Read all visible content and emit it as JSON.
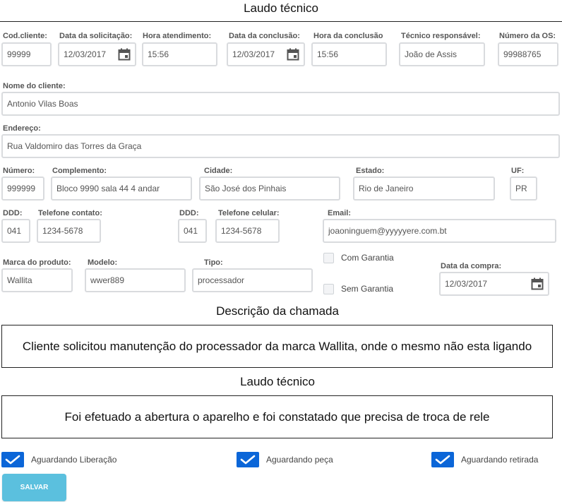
{
  "title": "Laudo técnico",
  "row1": {
    "cod_label": "Cod.cliente:",
    "cod_value": "99999",
    "data_sol_label": "Data da solicitação:",
    "data_sol_value": "12/03/2017",
    "hora_at_label": "Hora atendimento:",
    "hora_at_value": "15:56",
    "data_conc_label": "Data da conclusão:",
    "data_conc_value": "12/03/2017",
    "hora_conc_label": "Hora da conclusão",
    "hora_conc_value": "15:56",
    "tecnico_label": "Técnico responsável:",
    "tecnico_value": "João de Assis",
    "os_label": "Número da OS:",
    "os_value": "99988765"
  },
  "cliente": {
    "label": "Nome do cliente:",
    "value": "Antonio Vilas Boas"
  },
  "endereco": {
    "label": "Endereço:",
    "value": "Rua Valdomiro das Torres da Graça"
  },
  "row4": {
    "numero_label": "Número:",
    "numero_value": "999999",
    "complemento_label": "Complemento:",
    "complemento_value": "Bloco 9990 sala 44 4 andar",
    "cidade_label": "Cidade:",
    "cidade_value": "São José dos Pinhais",
    "estado_label": "Estado:",
    "estado_value": "Rio de Janeiro",
    "uf_label": "UF:",
    "uf_value": "PR"
  },
  "row5": {
    "ddd1_label": "DDD:",
    "ddd1_value": "041",
    "tel_label": "Telefone contato:",
    "tel_value": "1234-5678",
    "ddd2_label": "DDD:",
    "ddd2_value": "041",
    "cel_label": "Telefone celular:",
    "cel_value": "1234-5678",
    "email_label": "Email:",
    "email_value": "joaoninguem@yyyyyere.com.bt"
  },
  "row6": {
    "marca_label": "Marca do produto:",
    "marca_value": "Wallita",
    "modelo_label": "Modelo:",
    "modelo_value": "wwer889",
    "tipo_label": "Tipo:",
    "tipo_value": "processador",
    "com_garantia_label": "Com Garantia",
    "sem_garantia_label": "Sem Garantia",
    "compra_label": "Data da compra:",
    "compra_value": "12/03/2017"
  },
  "descricao": {
    "heading": "Descrição da chamada",
    "text": "Cliente solicitou manutenção do processador da marca Wallita, onde o mesmo não esta ligando"
  },
  "laudo": {
    "heading": "Laudo técnico",
    "text": "Foi efetuado a abertura o aparelho e foi constatado que precisa de troca de rele"
  },
  "status": {
    "liberacao": "Aguardando Liberação",
    "peca": "Aguardando peça",
    "retirada": "Aguardando retirada"
  },
  "save_label": "SALVAR",
  "colors": {
    "accent": "#0b66d8",
    "save": "#5bc0de",
    "border": "#d9dbde"
  }
}
